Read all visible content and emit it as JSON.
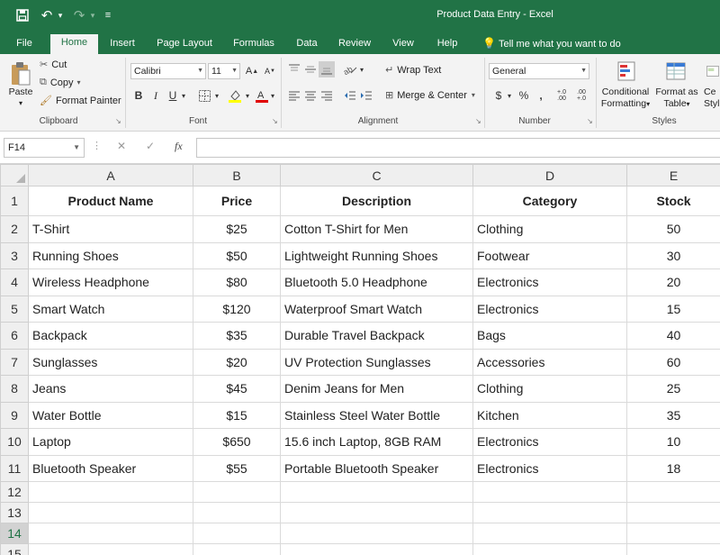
{
  "window_title": "Product Data Entry  -  Excel",
  "tabs": [
    "File",
    "Home",
    "Insert",
    "Page Layout",
    "Formulas",
    "Data",
    "Review",
    "View",
    "Help"
  ],
  "active_tab": "Home",
  "tell_me": "Tell me what you want to do",
  "ribbon": {
    "clipboard": {
      "paste": "Paste",
      "cut": "Cut",
      "copy": "Copy",
      "format_painter": "Format Painter",
      "label": "Clipboard"
    },
    "font": {
      "name": "Calibri",
      "size": "11",
      "bold": "B",
      "italic": "I",
      "underline": "U",
      "grow": "A",
      "shrink": "A",
      "label": "Font"
    },
    "alignment": {
      "wrap_text": "Wrap Text",
      "merge_center": "Merge & Center",
      "label": "Alignment"
    },
    "number": {
      "format": "General",
      "currency": "$",
      "percent": "%",
      "comma": ",",
      "inc_decimal": "+.0 .00",
      "dec_decimal": ".00 +.0",
      "label": "Number"
    },
    "styles": {
      "conditional_formatting": [
        "Conditional",
        "Formatting"
      ],
      "format_as_table": [
        "Format as",
        "Table"
      ],
      "cell_styles": [
        "Ce",
        "Style"
      ],
      "label": "Styles"
    }
  },
  "formula_bar": {
    "name_box": "F14",
    "cancel": "✕",
    "enter": "✓",
    "fx": "fx",
    "value": ""
  },
  "columns": [
    "A",
    "B",
    "C",
    "D",
    "E"
  ],
  "header_row": {
    "row": "1",
    "cells": [
      "Product Name",
      "Price",
      "Description",
      "Category",
      "Stock"
    ]
  },
  "rows": [
    {
      "row": "2",
      "cells": [
        "T-Shirt",
        "$25",
        "Cotton T-Shirt for Men",
        "Clothing",
        "50"
      ]
    },
    {
      "row": "3",
      "cells": [
        "Running Shoes",
        "$50",
        "Lightweight Running Shoes",
        "Footwear",
        "30"
      ]
    },
    {
      "row": "4",
      "cells": [
        "Wireless Headphone",
        "$80",
        "Bluetooth 5.0 Headphone",
        "Electronics",
        "20"
      ]
    },
    {
      "row": "5",
      "cells": [
        "Smart Watch",
        "$120",
        "Waterproof Smart Watch",
        "Electronics",
        "15"
      ]
    },
    {
      "row": "6",
      "cells": [
        "Backpack",
        "$35",
        "Durable Travel Backpack",
        "Bags",
        "40"
      ]
    },
    {
      "row": "7",
      "cells": [
        "Sunglasses",
        "$20",
        "UV Protection Sunglasses",
        "Accessories",
        "60"
      ]
    },
    {
      "row": "8",
      "cells": [
        "Jeans",
        "$45",
        "Denim Jeans for Men",
        "Clothing",
        "25"
      ]
    },
    {
      "row": "9",
      "cells": [
        "Water Bottle",
        "$15",
        "Stainless Steel Water Bottle",
        "Kitchen",
        "35"
      ]
    },
    {
      "row": "10",
      "cells": [
        "Laptop",
        "$650",
        "15.6 inch Laptop, 8GB RAM",
        "Electronics",
        "10"
      ]
    },
    {
      "row": "11",
      "cells": [
        "Bluetooth Speaker",
        "$55",
        "Portable Bluetooth Speaker",
        "Electronics",
        "18"
      ]
    }
  ],
  "empty_rows": [
    "12",
    "13",
    "14",
    "15"
  ],
  "selected_row": "14",
  "colors": {
    "accent": "#217346",
    "ribbon_bg": "#f3f3f3",
    "header_bg": "#efefef",
    "gridline": "#dadada"
  }
}
